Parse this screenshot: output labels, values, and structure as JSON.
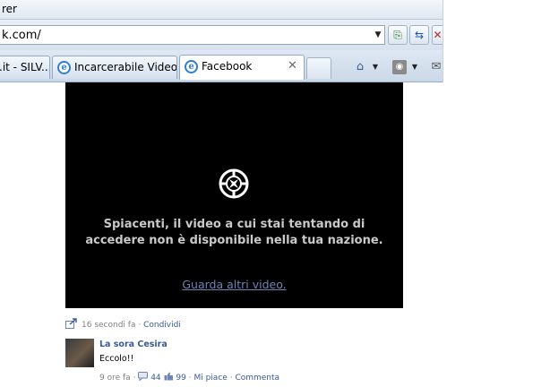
{
  "browser": {
    "title_fragment": "rer",
    "address_value": "k.com/",
    "tabs": [
      {
        "label": ".it - SILV..."
      },
      {
        "label": "Incarcerabile Video ..."
      },
      {
        "label": "Facebook",
        "close": "✕"
      }
    ],
    "icons": [
      "ie-icon",
      "home-icon",
      "feed-icon",
      "mail-icon",
      "refresh-icon",
      "stop-icon",
      "compatibility-icon"
    ]
  },
  "video": {
    "message": "Spiacenti, il video a cui stai tentando di accedere non è disponibile nella tua nazione.",
    "link": "Guarda altri video."
  },
  "post_meta": {
    "time": "16 secondi fa",
    "separator": "·",
    "share": "Condividi"
  },
  "comment": {
    "author": "La sora Cesira",
    "text": "Eccolo!!",
    "time": "9 ore fa",
    "comments_count": "44",
    "likes_count": "99",
    "like": "Mi piace",
    "comment": "Commenta"
  }
}
